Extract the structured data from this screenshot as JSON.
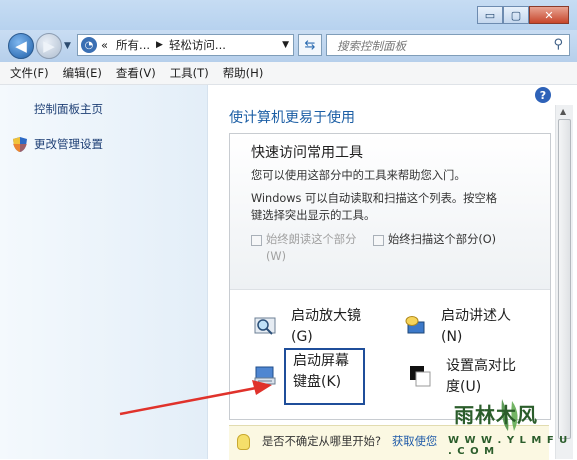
{
  "window": {
    "minimize": "▭",
    "maximize": "▢",
    "close": "✕"
  },
  "nav": {
    "back_icon": "arrow-left-icon",
    "forward_icon": "arrow-right-icon",
    "addr_icon_glyph": "◔",
    "breadcrumb": [
      "«",
      "所有...",
      "轻松访问..."
    ],
    "refresh_glyph": "⇆",
    "search_placeholder": "搜索控制面板",
    "search_glyph": "⚲"
  },
  "menu": [
    "文件(F)",
    "编辑(E)",
    "查看(V)",
    "工具(T)",
    "帮助(H)"
  ],
  "sidebar": {
    "home": "控制面板主页",
    "admin": "更改管理设置"
  },
  "main": {
    "help": "?",
    "title": "使计算机更易于使用",
    "quick_heading": "快速访问常用工具",
    "line1": "您可以使用这部分中的工具来帮助您入门。",
    "line2a": "Windows 可以自动读取和扫描这个列表。按空格",
    "line2b": "键选择突出显示的工具。",
    "cb_read_a": "始终朗读这个部分",
    "cb_read_b": "(W)",
    "cb_scan": "始终扫描这个部分(O)",
    "tools": {
      "magnifier_a": "启动放大镜",
      "magnifier_b": "(G)",
      "narrator_a": "启动讲述人",
      "narrator_b": "(N)",
      "osk_a": "启动屏幕",
      "osk_b": "键盘(K)",
      "contrast_a": "设置高对比",
      "contrast_b": "度(U)"
    },
    "tip_text": "是否不确定从哪里开始?",
    "tip_link": "获取使您"
  },
  "watermark": {
    "title": "雨林木风",
    "sub": "W W W . Y L M F U . C O M"
  },
  "colors": {
    "link": "#1e3f75",
    "title": "#1d5fa5",
    "arrow": "#e0322b",
    "highlight": "#1f4e9a"
  }
}
